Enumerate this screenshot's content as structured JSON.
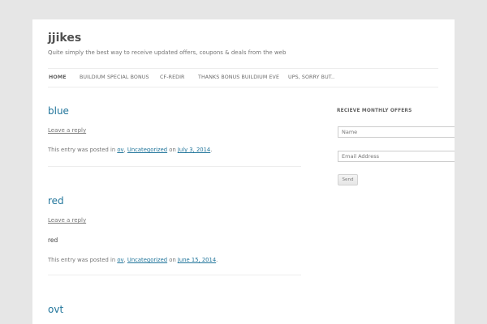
{
  "site": {
    "title": "jjikes",
    "description": "Quite simply the best way to receive updated offers, coupons & deals from the web"
  },
  "nav": {
    "items": [
      "Home",
      "BUILDIUM SPECIAL BONUS",
      "CF-REDIR",
      "THANKS BONUS BUILDIUM EVE",
      "UPS, SORRY BUT.."
    ]
  },
  "posts": [
    {
      "title": "blue",
      "reply": "Leave a reply",
      "content": "",
      "meta_prefix": "This entry was posted in",
      "cat1": "ov",
      "comma": ",",
      "cat2": "Uncategorized",
      "on": "on",
      "date": "July 3, 2014",
      "dot": "."
    },
    {
      "title": "red",
      "reply": "Leave a reply",
      "content": "red",
      "meta_prefix": "This entry was posted in",
      "cat1": "ov",
      "comma": ",",
      "cat2": "Uncategorized",
      "on": "on",
      "date": "June 15, 2014",
      "dot": "."
    },
    {
      "title": "ovt"
    }
  ],
  "sidebar": {
    "widget_title": "RECIEVE MONTHLY OFFERS",
    "name_placeholder": "Name",
    "email_placeholder": "Email Address",
    "send_label": "Send"
  }
}
